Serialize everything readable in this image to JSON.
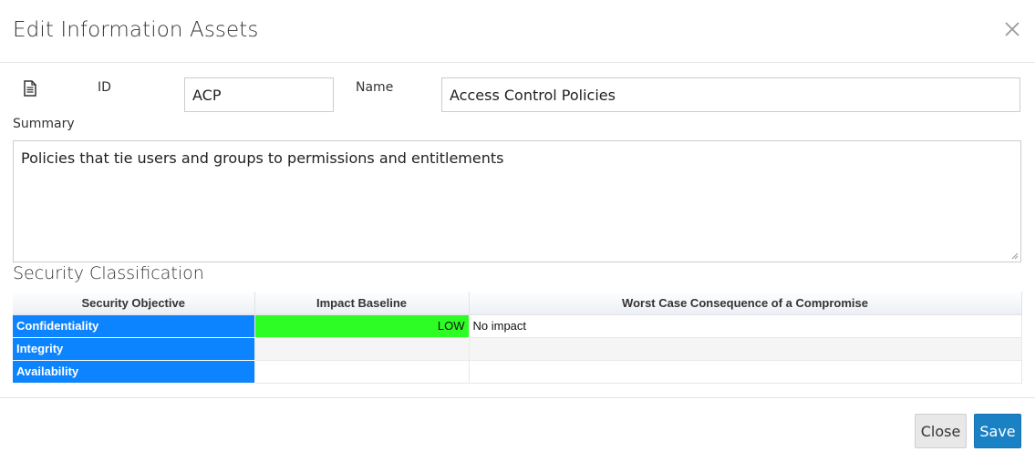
{
  "dialog": {
    "title": "Edit Information Assets"
  },
  "form": {
    "id_label": "ID",
    "id_value": "ACP",
    "name_label": "Name",
    "name_value": "Access Control Policies",
    "summary_label": "Summary",
    "summary_value": "Policies that tie users and groups to permissions and entitlements"
  },
  "security": {
    "section_title": "Security Classification",
    "columns": [
      "Security Objective",
      "Impact Baseline",
      "Worst Case Consequence of a Compromise"
    ],
    "rows": [
      {
        "objective": "Confidentiality",
        "impact": "LOW",
        "consequence": "No impact"
      },
      {
        "objective": "Integrity",
        "impact": "",
        "consequence": ""
      },
      {
        "objective": "Availability",
        "impact": "",
        "consequence": ""
      }
    ],
    "colors": {
      "objective_bg": "#0d84ff",
      "low_bg": "#2efc25"
    }
  },
  "footer": {
    "close_label": "Close",
    "save_label": "Save"
  },
  "icons": [
    "close-icon",
    "document-icon"
  ]
}
